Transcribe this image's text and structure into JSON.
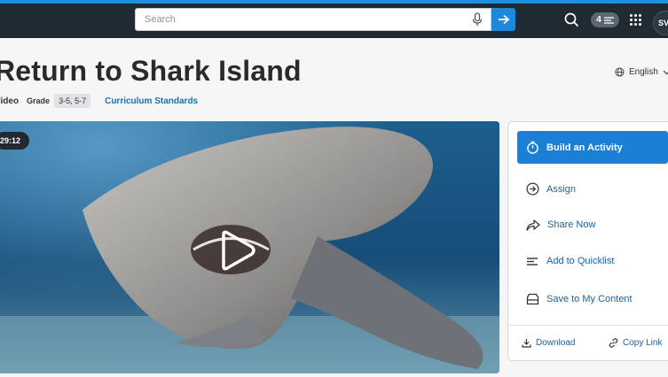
{
  "header": {
    "search": {
      "placeholder": "Search"
    },
    "quicklist_count": "4",
    "avatar_initials": "SV"
  },
  "page": {
    "title": "Return to Shark Island",
    "language": "English",
    "media_type": "Video",
    "grade_label": "Grade",
    "grade_value": "3-5, 5-7",
    "standards_link": "Curriculum Standards"
  },
  "video": {
    "duration": "29:12"
  },
  "actions": {
    "build": "Build an Activity",
    "assign": "Assign",
    "share": "Share Now",
    "quicklist": "Add to Quicklist",
    "save": "Save to My Content",
    "download": "Download",
    "copy_link": "Copy Link"
  },
  "colors": {
    "accent": "#1c7fd6",
    "topbar": "#1f2a33",
    "link": "#1c5f9e"
  }
}
